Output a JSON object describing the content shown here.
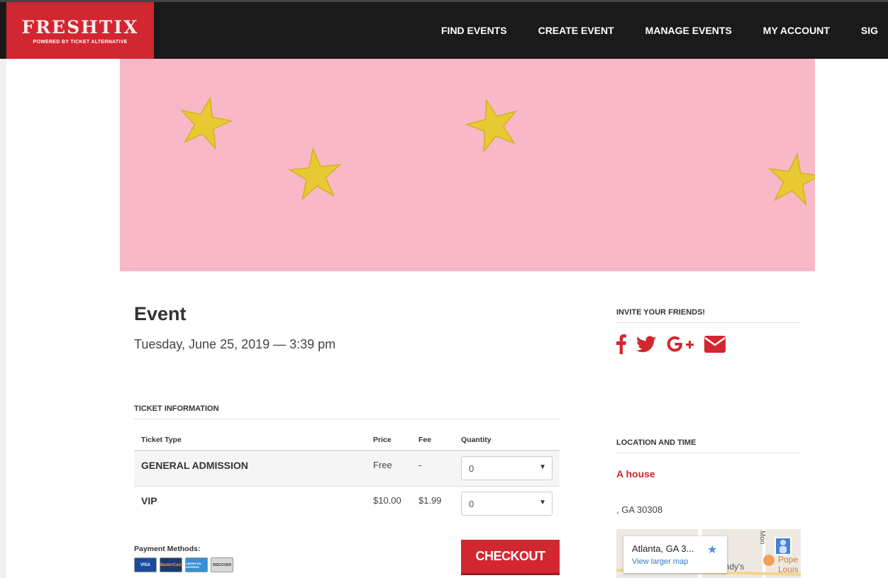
{
  "header": {
    "logo_main": "FRESHTIX",
    "logo_sub": "POWERED BY TICKET ALTERNATIVE",
    "nav": [
      "FIND EVENTS",
      "CREATE EVENT",
      "MANAGE EVENTS",
      "MY ACCOUNT",
      "SIG"
    ]
  },
  "event": {
    "title": "Event",
    "date": "Tuesday, June 25, 2019 — 3:39 pm"
  },
  "tickets": {
    "heading": "TICKET INFORMATION",
    "columns": [
      "Ticket Type",
      "Price",
      "Fee",
      "Quantity"
    ],
    "rows": [
      {
        "type": "GENERAL ADMISSION",
        "price": "Free",
        "fee": "-",
        "quantity": "0"
      },
      {
        "type": "VIP",
        "price": "$10.00",
        "fee": "$1.99",
        "quantity": "0"
      }
    ]
  },
  "payment": {
    "label": "Payment Methods:",
    "cards": [
      "VISA",
      "MasterCard",
      "AMERICAN EXPRESS",
      "DISCOVER"
    ]
  },
  "checkout_label": "CHECKOUT",
  "invite": {
    "heading": "INVITE YOUR FRIENDS!",
    "icons": [
      "facebook-icon",
      "twitter-icon",
      "google-plus-icon",
      "email-icon"
    ]
  },
  "location": {
    "heading": "LOCATION AND TIME",
    "venue": "A house",
    "address": ", GA 30308",
    "map_title": "Atlanta, GA 3...",
    "map_link": "View larger map",
    "map_labels": [
      "endy's",
      "Pope",
      "Louis",
      "Mon"
    ]
  },
  "colors": {
    "brand_red": "#d22630",
    "banner_pink": "#f9b8c7",
    "star_gold": "#e8c933"
  }
}
